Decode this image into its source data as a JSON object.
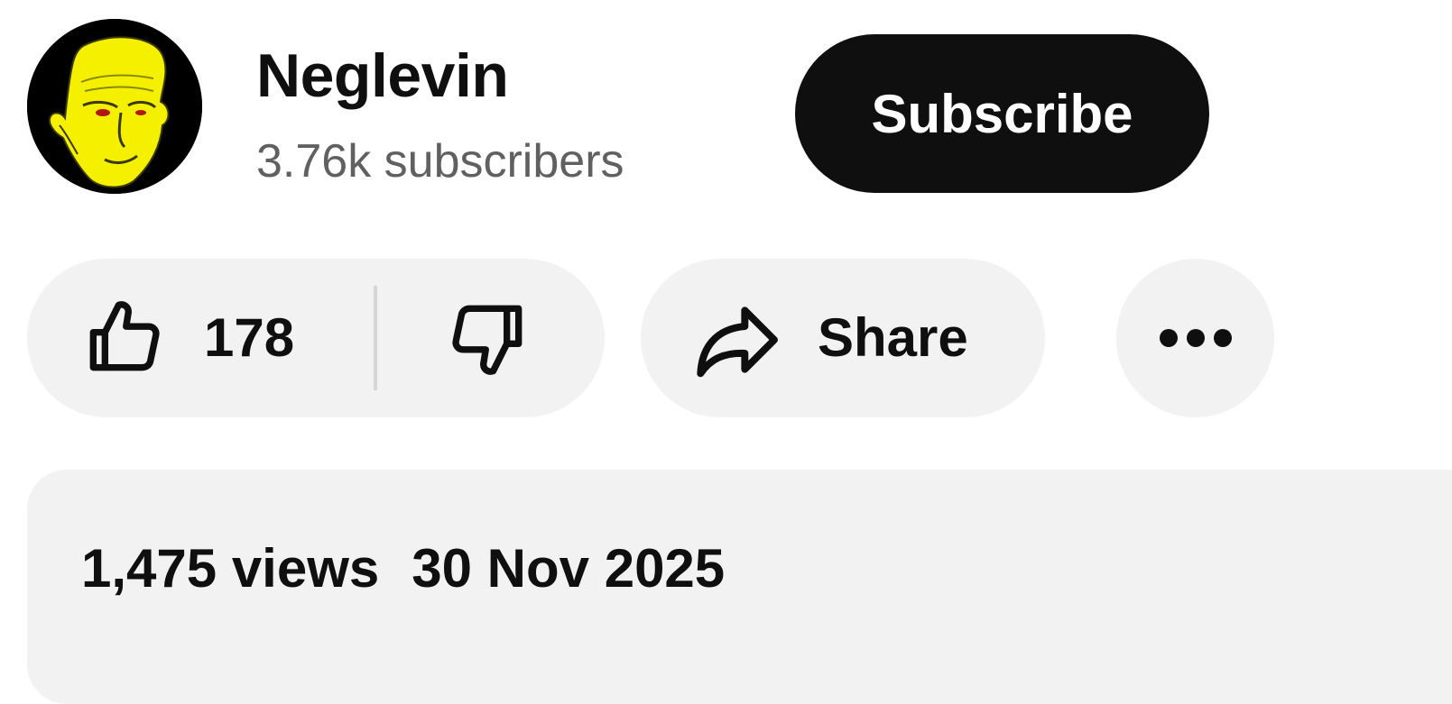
{
  "channel": {
    "name": "Neglevin",
    "subscribers": "3.76k subscribers",
    "avatar_icon": "yellow-face-avatar",
    "subscribe_label": "Subscribe"
  },
  "actions": {
    "like_icon": "thumbs-up-icon",
    "like_count": "178",
    "dislike_icon": "thumbs-down-icon",
    "share_icon": "share-arrow-icon",
    "share_label": "Share",
    "more_icon": "more-horizontal-icon"
  },
  "description": {
    "views": "1,475 views",
    "date": "30 Nov 2025"
  },
  "colors": {
    "subscribe_bg": "#0f0f0f",
    "pill_bg": "#f2f2f2",
    "secondary_text": "#606060",
    "avatar_face": "#f5f000"
  }
}
